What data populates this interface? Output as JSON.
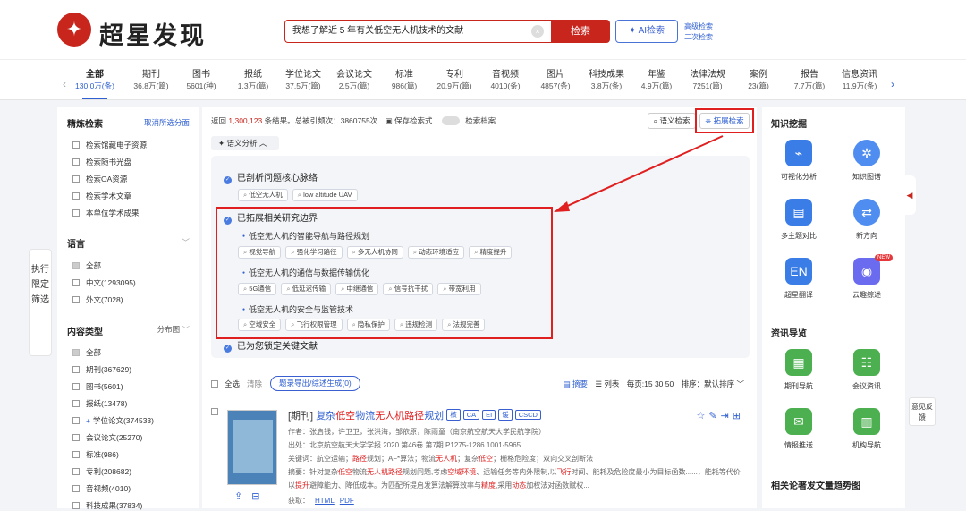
{
  "brand": {
    "logo_glyph": "✦",
    "name": "超星发现",
    "accent": "#c8251d",
    "link": "#2f5fd0"
  },
  "search": {
    "query": "我想了解近 5 年有关低空无人机技术的文献",
    "button": "检索",
    "ai_button": "✦ AI检索",
    "advanced": "高级检索",
    "secondary": "二次检索",
    "clear": "×"
  },
  "categories": [
    {
      "name": "全部",
      "count": "130.0万(条)"
    },
    {
      "name": "期刊",
      "count": "36.8万(篇)"
    },
    {
      "name": "图书",
      "count": "5601(种)"
    },
    {
      "name": "报纸",
      "count": "1.3万(篇)"
    },
    {
      "name": "学位论文",
      "count": "37.5万(篇)"
    },
    {
      "name": "会议论文",
      "count": "2.5万(篇)"
    },
    {
      "name": "标准",
      "count": "986(篇)"
    },
    {
      "name": "专利",
      "count": "20.9万(篇)"
    },
    {
      "name": "音视频",
      "count": "4010(条)"
    },
    {
      "name": "图片",
      "count": "4857(条)"
    },
    {
      "name": "科技成果",
      "count": "3.8万(条)"
    },
    {
      "name": "年鉴",
      "count": "4.9万(篇)"
    },
    {
      "name": "法律法规",
      "count": "7251(篇)"
    },
    {
      "name": "案例",
      "count": "23(篇)"
    },
    {
      "name": "报告",
      "count": "7.7万(篇)"
    },
    {
      "name": "信息资讯",
      "count": "11.9万(条)"
    }
  ],
  "left": {
    "refine_title": "精炼检索",
    "cancel_link": "取消所选分面",
    "refine_items": [
      "检索馆藏电子资源",
      "检索随书光盘",
      "检索OA资源",
      "检索学术文章",
      "本单位学术成果"
    ],
    "lang_title": "语言",
    "lang_items": [
      "全部",
      "中文(1293095)",
      "外文(7028)"
    ],
    "type_title": "内容类型",
    "type_link": "分布图",
    "type_items": [
      "全部",
      "期刊(367629)",
      "图书(5601)",
      "报纸(13478)",
      "学位论文(374533)",
      "会议论文(25270)",
      "标准(986)",
      "专利(208682)",
      "音视频(4010)",
      "科技成果(37834)"
    ],
    "filter_tab": "执行限定筛选"
  },
  "main": {
    "stat_prefix": "返回",
    "stat_count": "1,300,123",
    "stat_mid": "条结果。总被引频次：3860755次",
    "save": "保存检索式",
    "archive": "检索档案",
    "semantic_btn": "语义检索",
    "expand_btn": "拓展检索",
    "analysis": "语义分析 ︿",
    "step1": "已剖析问题核心脉络",
    "step1_tags": [
      "低空无人机",
      "low altitude UAV"
    ],
    "step2": "已拓展相关研究边界",
    "sub1": "低空无人机的智能导航与路径规划",
    "sub1_tags": [
      "视觉导航",
      "强化学习路径",
      "多无人机协同",
      "动态环境适应",
      "精度提升"
    ],
    "sub2": "低空无人机的通信与数据传输优化",
    "sub2_tags": [
      "5G通信",
      "低延迟传输",
      "中继通信",
      "信号抗干扰",
      "带宽利用"
    ],
    "sub3": "低空无人机的安全与监管技术",
    "sub3_tags": [
      "空域安全",
      "飞行权限管理",
      "隐私保护",
      "违规检测",
      "法规完善"
    ],
    "step3": "已为您锁定关键文献"
  },
  "list": {
    "select_all": "全选",
    "clear": "清除",
    "export": "题录导出/综述生成(0)",
    "view_abs": "摘要",
    "view_list": "列表",
    "per_page": "每页:",
    "pages": "15  30  50",
    "sort": "排序：",
    "sort_val": "默认排序 ﹀"
  },
  "result": {
    "type": "[期刊]",
    "t1": "复杂",
    "t2": "低空",
    "t3": "物流",
    "t4": "无人机",
    "t5": "路径",
    "t6": "规划",
    "badges": [
      "核",
      "CA",
      "EI",
      "谖",
      "CSCD"
    ],
    "authors": "作者：张启钱，许卫卫，张洪海，邹依原，陈雨童（南京航空航天大学民航学院）",
    "source": "出处：北京航空航天大学学报  2020 第46卷 第7期 P1275-1286  1001-5965",
    "kw_a": "关键词：航空运输；",
    "kw_b": "路径",
    "kw_c": "规划；A−*算法；物流",
    "kw_d": "无人机",
    "kw_e": "；复杂",
    "kw_f": "低空",
    "kw_g": "；栅格危险度；双向交叉剖断法",
    "abs1_a": "摘要：针对复杂",
    "abs1_b": "低空",
    "abs1_c": "物流",
    "abs1_d": "无人机路径",
    "abs1_e": "规划问题,考虑",
    "abs1_f": "空域环境",
    "abs1_g": "、运输任务等内外限制,以",
    "abs1_h": "飞行",
    "abs1_i": "时间、能耗及危险度最小为目标函数......，能耗等代价",
    "abs2_a": "以",
    "abs2_b": "提升",
    "abs2_c": "避障能力、降低成本。为匹配所提启发算法解算效率与",
    "abs2_d": "精度",
    "abs2_e": ",采用",
    "abs2_f": "动态",
    "abs2_g": "加权法对函数赋权...",
    "get": "获取：",
    "html": "HTML",
    "pdf": "PDF",
    "icons": "☆✎⇥⊞"
  },
  "right": {
    "title": "知识挖掘",
    "tools": [
      {
        "label": "可视化分析",
        "icon": "chart-icon",
        "glyph": "⌁"
      },
      {
        "label": "知识图谱",
        "icon": "graph-icon",
        "glyph": "✲"
      },
      {
        "label": "多主题对比",
        "icon": "compare-icon",
        "glyph": "▤"
      },
      {
        "label": "新方向",
        "icon": "direction-icon",
        "glyph": "⇄"
      },
      {
        "label": "超星翻译",
        "icon": "translate-icon",
        "glyph": "EN"
      },
      {
        "label": "云趣综述",
        "icon": "summary-icon",
        "glyph": "◉"
      }
    ],
    "new": "NEW",
    "news_title": "资讯导览",
    "news": [
      {
        "label": "期刊导航",
        "icon": "journal-icon",
        "glyph": "▦"
      },
      {
        "label": "会议资讯",
        "icon": "meeting-icon",
        "glyph": "☷"
      },
      {
        "label": "情报推送",
        "icon": "push-icon",
        "glyph": "✉"
      },
      {
        "label": "机构导航",
        "icon": "org-icon",
        "glyph": "▥"
      }
    ],
    "trend_title": "相关论著发文量趋势图"
  },
  "feedback": "意见反馈"
}
